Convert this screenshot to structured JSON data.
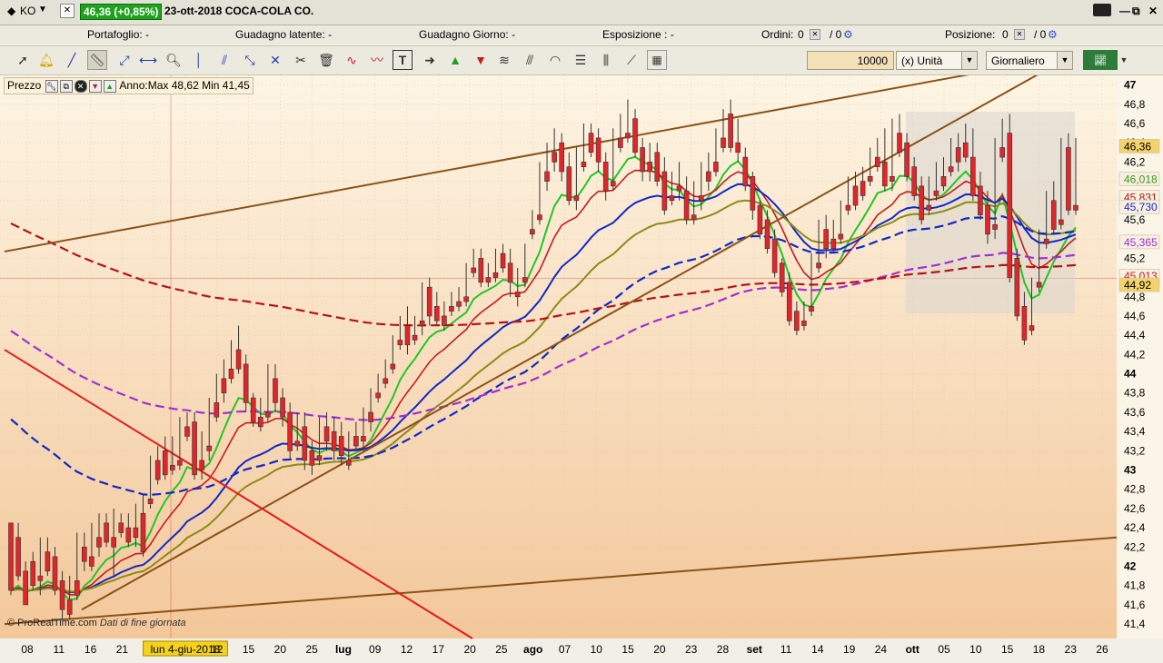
{
  "titlebar": {
    "symbol": "KO",
    "price_change": "46,36 (+0,85%)",
    "date_name": "23-ott-2018 COCA-COLA CO."
  },
  "status": {
    "portafoglio": "Portafoglio: -",
    "guadagno_latente": "Guadagno latente: -",
    "guadagno_giorno": "Guadagno Giorno: -",
    "esposizione": "Esposizione : -",
    "ordini_label": "Ordini:",
    "ordini_value": "0",
    "ordini_sep": "/ 0",
    "posizione_label": "Posizione:",
    "posizione_value": "0",
    "posizione_sep": "/ 0"
  },
  "toolbar": {
    "quantity": "10000",
    "unit": "(x) Unità",
    "period": "Giornaliero"
  },
  "legend": {
    "label": "Prezzo",
    "range": "Anno:Max 48,62 Min 41,45"
  },
  "watermark": {
    "brand": "© ProRealTime.com",
    "note": "Dati di fine giornata"
  },
  "chart_data": {
    "type": "candlestick",
    "y_ticks": [
      "47",
      "46,8",
      "46,6",
      "46,4",
      "46,2",
      "46",
      "45,8",
      "45,6",
      "45,4",
      "45,2",
      "45",
      "44,8",
      "44,6",
      "44,4",
      "44,2",
      "44",
      "43,8",
      "43,6",
      "43,4",
      "43,2",
      "43",
      "42,8",
      "42,6",
      "42,4",
      "42,2",
      "42",
      "41,8",
      "41,6",
      "41,4"
    ],
    "ylim": [
      41.25,
      47.1
    ],
    "x_ticks": [
      "08",
      "11",
      "16",
      "21",
      "24",
      "lun 4-giu-2018",
      "12",
      "15",
      "20",
      "25",
      "lug",
      "09",
      "12",
      "17",
      "20",
      "25",
      "ago",
      "07",
      "10",
      "15",
      "20",
      "23",
      "28",
      "set",
      "11",
      "14",
      "19",
      "24",
      "ott",
      "05",
      "10",
      "15",
      "18",
      "23",
      "26"
    ],
    "price_labels": [
      {
        "value": "46,36",
        "color": "#f3d36b",
        "text_color": "#000"
      },
      {
        "value": "46,018",
        "color": "#f7efe0",
        "text_color": "#3a9a1a"
      },
      {
        "value": "45,831",
        "color": "#f7efe0",
        "text_color": "#b31414"
      },
      {
        "value": "45,730",
        "color": "#f7efe0",
        "text_color": "#1a2ec2"
      },
      {
        "value": "45,365",
        "color": "#f7efe0",
        "text_color": "#9a2fd0"
      },
      {
        "value": "45,013",
        "color": "#f7efe0",
        "text_color": "#c21a1a"
      },
      {
        "value": "44,92",
        "color": "#f3d36b",
        "text_color": "#000"
      }
    ],
    "candles": [
      [
        42.45,
        42.35,
        41.75,
        41.7
      ],
      [
        42.3,
        42.45,
        41.9,
        41.85
      ],
      [
        41.95,
        42.05,
        41.6,
        41.65
      ],
      [
        42.05,
        42.15,
        41.8,
        41.75
      ],
      [
        41.9,
        42.3,
        41.85,
        41.7
      ],
      [
        42.15,
        42.3,
        41.95,
        41.9
      ],
      [
        42.1,
        42.2,
        41.75,
        41.7
      ],
      [
        41.85,
        41.95,
        41.55,
        41.45
      ],
      [
        41.65,
        41.9,
        41.5,
        41.45
      ],
      [
        41.85,
        42.35,
        41.7,
        41.65
      ],
      [
        42.2,
        42.35,
        42.05,
        41.95
      ],
      [
        42.1,
        42.45,
        42.0,
        41.95
      ],
      [
        42.3,
        42.55,
        42.2,
        42.1
      ],
      [
        42.45,
        42.55,
        42.25,
        42.2
      ],
      [
        42.3,
        42.6,
        42.2,
        41.9
      ],
      [
        42.45,
        42.55,
        42.35,
        42.3
      ],
      [
        42.4,
        42.55,
        42.25,
        42.2
      ],
      [
        42.4,
        42.65,
        42.3,
        42.2
      ],
      [
        42.55,
        42.75,
        42.15,
        42.1
      ],
      [
        42.7,
        43.15,
        42.65,
        42.6
      ],
      [
        43.1,
        43.25,
        42.9,
        42.85
      ],
      [
        43.2,
        43.35,
        42.95,
        42.9
      ],
      [
        43.05,
        43.35,
        43.0,
        42.95
      ],
      [
        43.1,
        43.55,
        43.05,
        43.0
      ],
      [
        43.45,
        43.6,
        43.35,
        43.3
      ],
      [
        43.5,
        43.6,
        42.95,
        42.9
      ],
      [
        43.1,
        43.4,
        43.0,
        42.9
      ],
      [
        43.25,
        43.75,
        43.2,
        43.1
      ],
      [
        43.7,
        44.0,
        43.55,
        43.5
      ],
      [
        43.95,
        44.15,
        43.8,
        43.7
      ],
      [
        44.05,
        44.35,
        43.95,
        43.9
      ],
      [
        44.25,
        44.5,
        44.05,
        44.0
      ],
      [
        44.1,
        44.2,
        43.7,
        43.6
      ],
      [
        43.75,
        43.8,
        43.5,
        43.45
      ],
      [
        43.55,
        43.75,
        43.45,
        43.4
      ],
      [
        43.6,
        44.1,
        43.55,
        43.5
      ],
      [
        43.95,
        44.1,
        43.7,
        43.6
      ],
      [
        43.75,
        43.85,
        43.55,
        43.45
      ],
      [
        43.6,
        43.7,
        43.2,
        43.1
      ],
      [
        43.3,
        43.6,
        43.25,
        43.2
      ],
      [
        43.45,
        43.6,
        43.1,
        43.0
      ],
      [
        43.2,
        43.3,
        43.05,
        42.95
      ],
      [
        43.15,
        43.55,
        43.1,
        43.05
      ],
      [
        43.45,
        43.6,
        43.3,
        43.2
      ],
      [
        43.4,
        43.55,
        43.2,
        43.1
      ],
      [
        43.35,
        43.5,
        43.15,
        43.05
      ],
      [
        43.1,
        43.4,
        43.05,
        43.0
      ],
      [
        43.35,
        43.5,
        43.25,
        43.2
      ],
      [
        43.35,
        43.65,
        43.3,
        43.2
      ],
      [
        43.6,
        43.85,
        43.5,
        43.4
      ],
      [
        43.8,
        44.0,
        43.75,
        43.7
      ],
      [
        43.95,
        44.15,
        43.9,
        43.85
      ],
      [
        44.1,
        44.4,
        44.05,
        44.0
      ],
      [
        44.35,
        44.6,
        44.3,
        44.25
      ],
      [
        44.5,
        44.7,
        44.3,
        44.2
      ],
      [
        44.4,
        44.6,
        44.35,
        44.3
      ],
      [
        44.55,
        44.95,
        44.5,
        44.4
      ],
      [
        44.9,
        45.0,
        44.6,
        44.5
      ],
      [
        44.7,
        44.85,
        44.55,
        44.5
      ],
      [
        44.6,
        44.75,
        44.5,
        44.45
      ],
      [
        44.7,
        44.85,
        44.65,
        44.6
      ],
      [
        44.75,
        44.9,
        44.7,
        44.65
      ],
      [
        44.8,
        45.15,
        44.75,
        44.7
      ],
      [
        45.1,
        45.3,
        45.05,
        45.0
      ],
      [
        45.2,
        45.3,
        44.95,
        44.9
      ],
      [
        45.0,
        45.15,
        44.95,
        44.9
      ],
      [
        45.05,
        45.3,
        45.0,
        44.95
      ],
      [
        45.25,
        45.35,
        45.1,
        45.05
      ],
      [
        45.15,
        45.3,
        44.95,
        44.8
      ],
      [
        44.85,
        45.1,
        44.8,
        44.7
      ],
      [
        45.0,
        45.35,
        44.95,
        44.9
      ],
      [
        45.5,
        45.7,
        45.45,
        45.4
      ],
      [
        45.65,
        46.2,
        45.6,
        45.55
      ],
      [
        46.1,
        46.4,
        46.0,
        45.9
      ],
      [
        46.3,
        46.55,
        46.2,
        46.1
      ],
      [
        46.4,
        46.5,
        46.1,
        46.0
      ],
      [
        46.15,
        46.3,
        45.8,
        45.75
      ],
      [
        45.85,
        46.35,
        45.8,
        45.7
      ],
      [
        46.2,
        46.6,
        46.15,
        46.1
      ],
      [
        46.5,
        46.6,
        46.3,
        46.25
      ],
      [
        46.45,
        46.55,
        46.2,
        46.1
      ],
      [
        46.2,
        46.3,
        45.9,
        45.8
      ],
      [
        46.0,
        46.55,
        45.95,
        45.9
      ],
      [
        46.45,
        46.7,
        46.35,
        46.3
      ],
      [
        46.5,
        46.85,
        46.45,
        46.4
      ],
      [
        46.65,
        46.75,
        46.3,
        46.25
      ],
      [
        46.35,
        46.45,
        46.1,
        46.0
      ],
      [
        46.2,
        46.4,
        46.1,
        46.0
      ],
      [
        46.3,
        46.4,
        46.0,
        45.95
      ],
      [
        46.1,
        46.25,
        45.7,
        45.65
      ],
      [
        45.85,
        46.1,
        45.8,
        45.75
      ],
      [
        45.95,
        46.2,
        45.9,
        45.8
      ],
      [
        45.9,
        46.05,
        45.6,
        45.55
      ],
      [
        45.65,
        46.0,
        45.6,
        45.55
      ],
      [
        45.85,
        46.2,
        45.8,
        45.7
      ],
      [
        46.1,
        46.3,
        46.0,
        45.9
      ],
      [
        46.2,
        46.55,
        46.1,
        46.05
      ],
      [
        46.45,
        46.75,
        46.35,
        46.3
      ],
      [
        46.7,
        46.85,
        46.35,
        46.3
      ],
      [
        46.4,
        46.65,
        46.3,
        46.2
      ],
      [
        46.25,
        46.35,
        45.95,
        45.9
      ],
      [
        46.05,
        46.1,
        45.7,
        45.6
      ],
      [
        45.75,
        45.8,
        45.45,
        45.4
      ],
      [
        45.6,
        45.7,
        45.3,
        45.25
      ],
      [
        45.4,
        45.5,
        45.05,
        45.0
      ],
      [
        45.15,
        45.2,
        44.85,
        44.8
      ],
      [
        44.95,
        45.05,
        44.55,
        44.5
      ],
      [
        44.65,
        44.75,
        44.45,
        44.4
      ],
      [
        44.55,
        44.75,
        44.5,
        44.45
      ],
      [
        44.7,
        45.25,
        44.65,
        44.6
      ],
      [
        45.15,
        45.6,
        45.1,
        45.05
      ],
      [
        45.5,
        45.65,
        45.3,
        45.2
      ],
      [
        45.4,
        45.6,
        45.3,
        45.25
      ],
      [
        45.45,
        45.8,
        45.4,
        45.35
      ],
      [
        45.75,
        46.05,
        45.7,
        45.65
      ],
      [
        45.95,
        46.1,
        45.75,
        45.7
      ],
      [
        46.0,
        46.15,
        45.85,
        45.8
      ],
      [
        46.05,
        46.35,
        46.0,
        45.95
      ],
      [
        46.25,
        46.45,
        46.15,
        46.1
      ],
      [
        46.2,
        46.55,
        45.95,
        45.9
      ],
      [
        46.05,
        46.65,
        46.0,
        45.9
      ],
      [
        46.5,
        46.7,
        46.3,
        46.25
      ],
      [
        46.4,
        46.5,
        46.05,
        46.0
      ],
      [
        46.15,
        46.25,
        45.85,
        45.8
      ],
      [
        45.95,
        46.05,
        45.6,
        45.55
      ],
      [
        45.75,
        46.05,
        45.7,
        45.65
      ],
      [
        45.9,
        46.2,
        45.85,
        45.8
      ],
      [
        46.05,
        46.25,
        45.95,
        45.9
      ],
      [
        46.15,
        46.45,
        46.1,
        46.05
      ],
      [
        46.35,
        46.5,
        46.2,
        46.1
      ],
      [
        46.4,
        46.6,
        46.25,
        46.2
      ],
      [
        46.25,
        46.55,
        45.85,
        45.8
      ],
      [
        45.95,
        46.1,
        45.65,
        45.6
      ],
      [
        45.75,
        45.9,
        45.45,
        45.35
      ],
      [
        45.55,
        46.45,
        45.5,
        45.4
      ],
      [
        46.35,
        46.65,
        46.25,
        46.2
      ],
      [
        46.5,
        46.7,
        45.0,
        44.95
      ],
      [
        45.2,
        45.3,
        44.6,
        44.55
      ],
      [
        44.7,
        44.85,
        44.35,
        44.3
      ],
      [
        44.5,
        45.0,
        44.45,
        44.4
      ],
      [
        44.95,
        45.5,
        44.9,
        44.85
      ],
      [
        45.4,
        45.9,
        45.35,
        45.3
      ],
      [
        45.8,
        46.0,
        45.5,
        45.45
      ],
      [
        45.6,
        46.45,
        45.55,
        45.5
      ],
      [
        46.35,
        46.5,
        45.7,
        45.65
      ],
      [
        45.75,
        46.45,
        45.7,
        45.65
      ]
    ]
  }
}
